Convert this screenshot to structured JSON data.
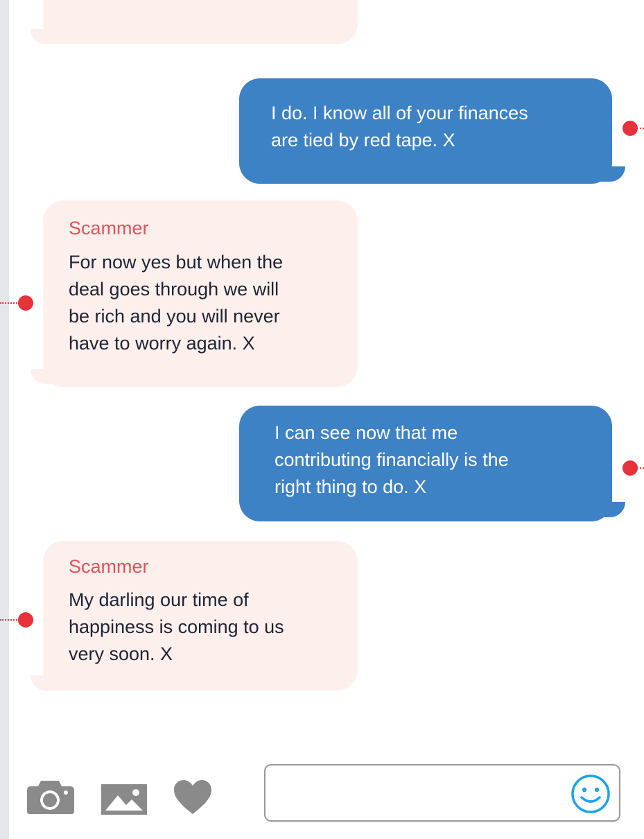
{
  "messages": [
    {
      "direction": "outgoing",
      "text_lines": [
        "I do. I know all of your finances",
        "are tied by red tape. X"
      ]
    },
    {
      "direction": "incoming",
      "sender": "Scammer",
      "text_lines": [
        "For now yes but when the",
        "deal goes through we will",
        "be rich and you will never",
        "have to worry again. X"
      ]
    },
    {
      "direction": "outgoing",
      "text_lines": [
        "I can see now that me",
        "contributing financially is the",
        "right thing to do. X"
      ]
    },
    {
      "direction": "incoming",
      "sender": "Scammer",
      "text_lines": [
        "My darling our time of",
        "happiness is coming to us",
        "very soon. X"
      ]
    }
  ],
  "composer": {
    "icons": [
      "camera-icon",
      "image-icon",
      "heart-icon"
    ],
    "input_value": "",
    "emoji_icon": "smiley-icon"
  },
  "colors": {
    "incoming_bubble": "#fdf0ec",
    "outgoing_bubble": "#3e82c6",
    "sender_name": "#e2515c",
    "incoming_text": "#1f2335",
    "annotation_dot": "#e8323b",
    "composer_icon": "#8a8a8a",
    "emoji_accent": "#1aa3e8"
  }
}
